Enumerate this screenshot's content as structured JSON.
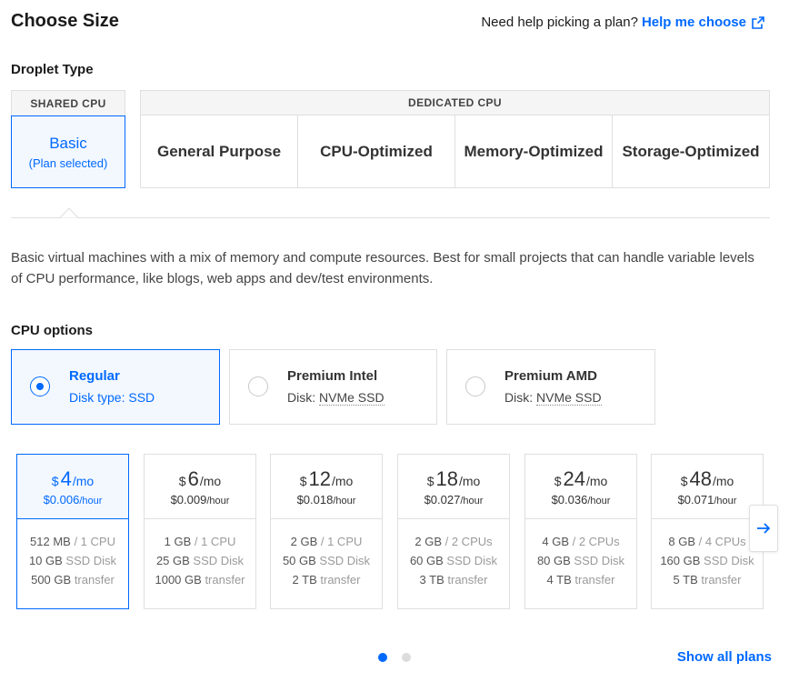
{
  "header": {
    "title": "Choose Size",
    "help_prompt": "Need help picking a plan?",
    "help_link": "Help me choose"
  },
  "droplet_type": {
    "label": "Droplet Type",
    "shared_heading": "SHARED CPU",
    "basic_name": "Basic",
    "basic_status": "(Plan selected)",
    "dedicated_heading": "DEDICATED CPU",
    "dedicated_options": [
      "General Purpose",
      "CPU-Optimized",
      "Memory-Optimized",
      "Storage-Optimized"
    ]
  },
  "description": "Basic virtual machines with a mix of memory and compute resources. Best for small projects that can handle variable levels of CPU performance, like blogs, web apps and dev/test environments.",
  "cpu_options": {
    "label": "CPU options",
    "items": [
      {
        "name": "Regular",
        "disk_label": "Disk type:",
        "disk_value": "SSD",
        "selected": true
      },
      {
        "name": "Premium Intel",
        "disk_label": "Disk:",
        "disk_value": "NVMe SSD",
        "selected": false
      },
      {
        "name": "Premium AMD",
        "disk_label": "Disk:",
        "disk_value": "NVMe SSD",
        "selected": false
      }
    ]
  },
  "plans": [
    {
      "currency": "$",
      "price": "4",
      "period": "/mo",
      "hourly": "$0.006",
      "hour_unit": "/hour",
      "memory": "512 MB",
      "cpu": "/ 1 CPU",
      "disk": "10 GB",
      "disk_type": "SSD Disk",
      "transfer": "500 GB",
      "transfer_label": "transfer",
      "selected": true
    },
    {
      "currency": "$",
      "price": "6",
      "period": "/mo",
      "hourly": "$0.009",
      "hour_unit": "/hour",
      "memory": "1 GB",
      "cpu": "/ 1 CPU",
      "disk": "25 GB",
      "disk_type": "SSD Disk",
      "transfer": "1000 GB",
      "transfer_label": "transfer",
      "selected": false
    },
    {
      "currency": "$",
      "price": "12",
      "period": "/mo",
      "hourly": "$0.018",
      "hour_unit": "/hour",
      "memory": "2 GB",
      "cpu": "/ 1 CPU",
      "disk": "50 GB",
      "disk_type": "SSD Disk",
      "transfer": "2 TB",
      "transfer_label": "transfer",
      "selected": false
    },
    {
      "currency": "$",
      "price": "18",
      "period": "/mo",
      "hourly": "$0.027",
      "hour_unit": "/hour",
      "memory": "2 GB",
      "cpu": "/ 2 CPUs",
      "disk": "60 GB",
      "disk_type": "SSD Disk",
      "transfer": "3 TB",
      "transfer_label": "transfer",
      "selected": false
    },
    {
      "currency": "$",
      "price": "24",
      "period": "/mo",
      "hourly": "$0.036",
      "hour_unit": "/hour",
      "memory": "4 GB",
      "cpu": "/ 2 CPUs",
      "disk": "80 GB",
      "disk_type": "SSD Disk",
      "transfer": "4 TB",
      "transfer_label": "transfer",
      "selected": false
    },
    {
      "currency": "$",
      "price": "48",
      "period": "/mo",
      "hourly": "$0.071",
      "hour_unit": "/hour",
      "memory": "8 GB",
      "cpu": "/ 4 CPUs",
      "disk": "160 GB",
      "disk_type": "SSD Disk",
      "transfer": "5 TB",
      "transfer_label": "transfer",
      "selected": false
    }
  ],
  "pagination": {
    "pages": 2,
    "active": 1
  },
  "footer": {
    "show_all": "Show all plans"
  },
  "colors": {
    "accent": "#0069ff",
    "border": "#dfdfdf",
    "selected_bg": "#f3f8ff"
  },
  "icons": {
    "help": "external-link-icon",
    "next": "arrow-right-icon"
  }
}
